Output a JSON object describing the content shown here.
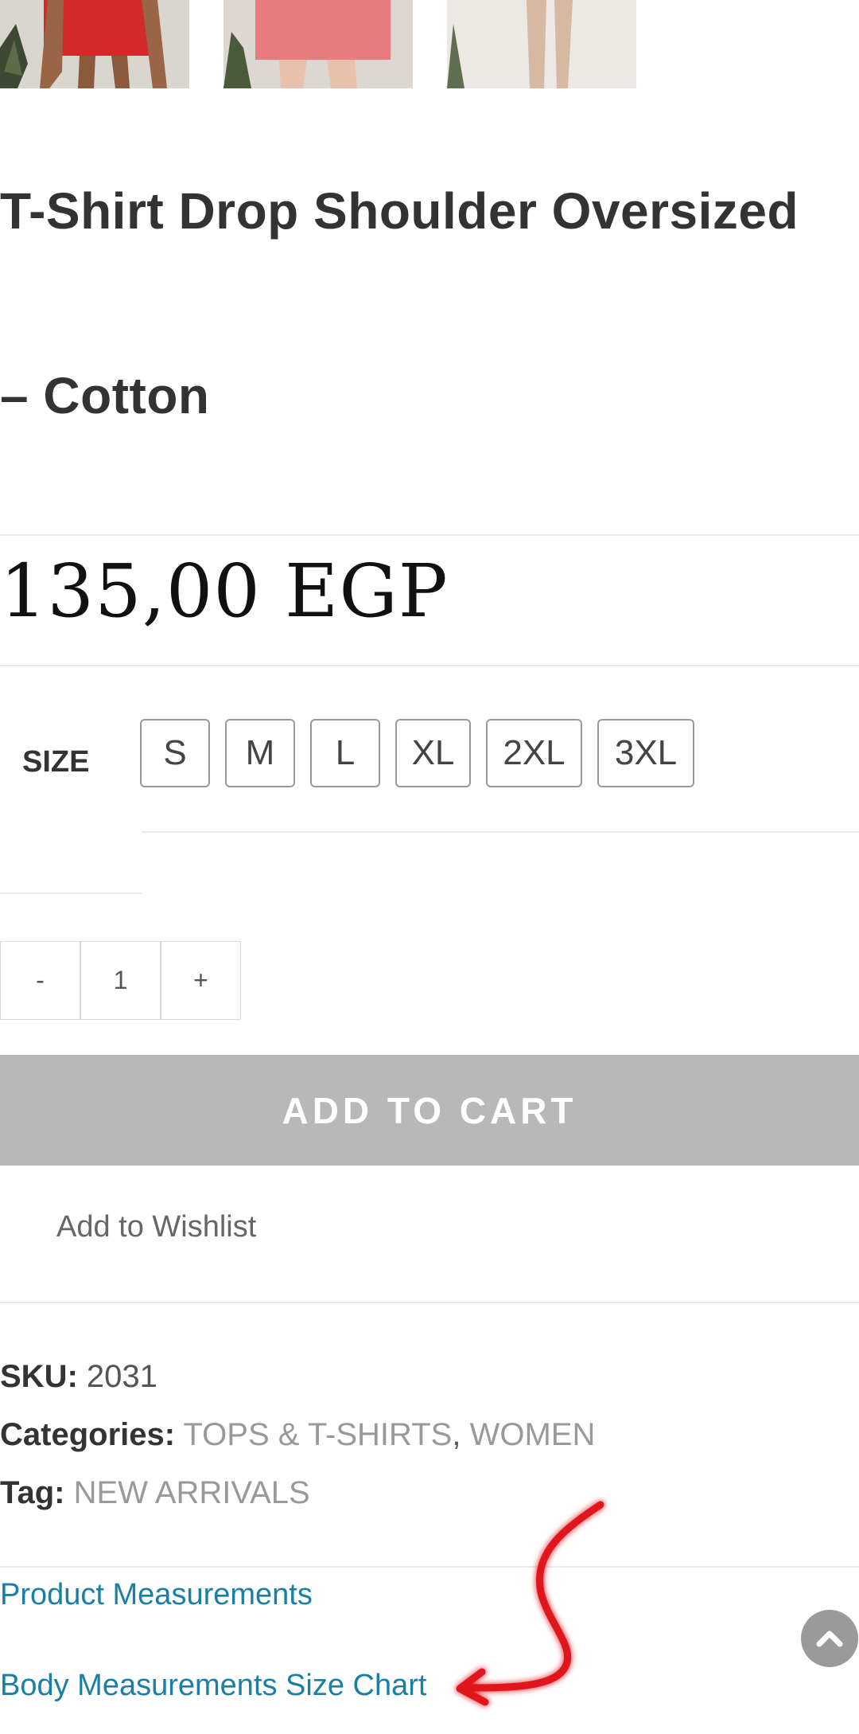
{
  "product": {
    "title_line1": "T-Shirt Drop Shoulder Oversized",
    "title_line2": "– Cotton",
    "price": "135,00 EGP"
  },
  "thumbnails": [
    {
      "name": "red dress model",
      "color": "#d32a2a"
    },
    {
      "name": "pink dress model",
      "color": "#e97b7f"
    },
    {
      "name": "legs model",
      "color": "#efe9e4"
    }
  ],
  "size": {
    "label": "SIZE",
    "options": [
      "S",
      "M",
      "L",
      "XL",
      "2XL",
      "3XL"
    ]
  },
  "quantity": {
    "minus": "-",
    "value": "1",
    "plus": "+"
  },
  "cart": {
    "add_label": "ADD TO CART",
    "wishlist_label": "Add to Wishlist"
  },
  "meta": {
    "sku_label": "SKU:",
    "sku_value": "2031",
    "categories_label": "Categories:",
    "category_1": "TOPS & T-SHIRTS",
    "separator": ",",
    "category_2": "WOMEN",
    "tag_label": "Tag:",
    "tag_value": "NEW ARRIVALS"
  },
  "links": {
    "product_measurements": "Product Measurements",
    "body_measurements": "Body Measurements Size Chart"
  },
  "colors": {
    "accent_link": "#1a7fa6",
    "button_gray": "#b8b8b8",
    "annotation_red": "#e0141c"
  },
  "icons": {
    "scroll_top": "chevron-up-icon",
    "annotation": "red-arrow-annotation"
  }
}
